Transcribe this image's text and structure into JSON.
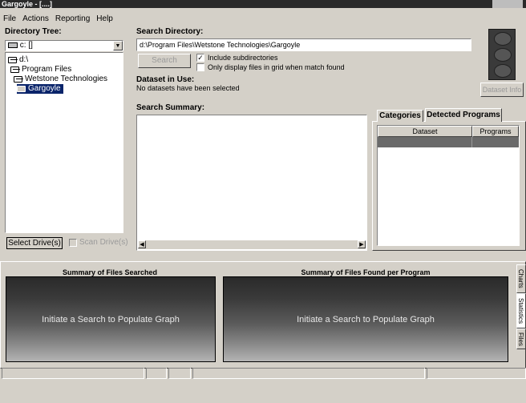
{
  "titlebar": {
    "title": "Gargoyle - [....]"
  },
  "menu": [
    {
      "label": "File"
    },
    {
      "label": "Actions"
    },
    {
      "label": "Reporting"
    },
    {
      "label": "Help"
    }
  ],
  "directory_tree": {
    "label": "Directory Tree:",
    "drive": "c: []",
    "items": [
      {
        "label": "d:\\"
      },
      {
        "label": "Program Files"
      },
      {
        "label": "Wetstone Technologies"
      },
      {
        "label": "Gargoyle"
      }
    ],
    "select_drives_button": "Select Drive(s)",
    "scan_drives_label": "Scan Drive(s)"
  },
  "search_directory": {
    "label": "Search Directory:",
    "path": "d:\\Program Files\\Wetstone Technologies\\Gargoyle",
    "search_button": "Search",
    "include_subdirectories": {
      "label": "Include subdirectories",
      "checked": true
    },
    "only_display": {
      "label": "Only display files in grid when match found",
      "checked": false
    }
  },
  "dataset": {
    "label": "Dataset in Use:",
    "value": "No datasets have been selected",
    "info_button": "Dataset Info"
  },
  "search_summary": {
    "label": "Search Summary:"
  },
  "tabs": {
    "categories": "Categories",
    "detected_programs": "Detected Programs"
  },
  "grid": {
    "columns": [
      "Dataset",
      "Programs"
    ]
  },
  "graphs": {
    "files_searched": {
      "title": "Summary of Files Searched",
      "placeholder": "Initiate a Search to Populate Graph"
    },
    "files_found": {
      "title": "Summary of Files Found per Program",
      "placeholder": "Initiate a Search to Populate Graph"
    }
  },
  "side_tabs": {
    "charts": "Charts",
    "statistics": "Statistics",
    "files": "Files"
  },
  "colors": {
    "window_bg": "#d4d0c8",
    "selection": "#0a246a"
  }
}
